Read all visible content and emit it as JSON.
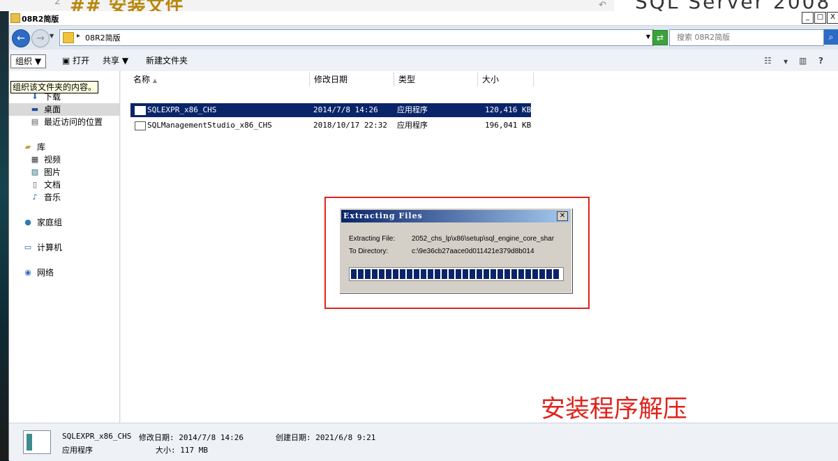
{
  "background": {
    "numeral": "2",
    "heading": "## 安装文件",
    "right_text": "SQL Server 2008"
  },
  "window": {
    "title": "08R2简版",
    "min_glyph": "_",
    "max_glyph": "□",
    "close_glyph": "X"
  },
  "address": {
    "path": "08R2简版",
    "search_placeholder": "搜索 08R2简版"
  },
  "toolbar": {
    "organize": "组织 ▼",
    "open": "打开",
    "share": "共享 ▼",
    "new_folder": "新建文件夹"
  },
  "tooltip": "组织该文件夹的内容。",
  "sidebar": {
    "items": [
      {
        "label": "下载",
        "icon": "download-icon"
      },
      {
        "label": "桌面",
        "icon": "desktop-icon",
        "selected": true
      },
      {
        "label": "最近访问的位置",
        "icon": "recent-places-icon"
      },
      {
        "label": "库",
        "icon": "library-icon"
      },
      {
        "label": "视频",
        "icon": "video-icon"
      },
      {
        "label": "图片",
        "icon": "pictures-icon"
      },
      {
        "label": "文档",
        "icon": "documents-icon"
      },
      {
        "label": "音乐",
        "icon": "music-icon"
      },
      {
        "label": "家庭组",
        "icon": "homegroup-icon"
      },
      {
        "label": "计算机",
        "icon": "computer-icon"
      },
      {
        "label": "网络",
        "icon": "network-icon"
      }
    ]
  },
  "columns": {
    "name": "名称",
    "modified": "修改日期",
    "type": "类型",
    "size": "大小"
  },
  "files": [
    {
      "name": "SQLEXPR_x86_CHS",
      "modified": "2014/7/8 14:26",
      "type": "应用程序",
      "size": "120,416 KB",
      "selected": true
    },
    {
      "name": "SQLManagementStudio_x86_CHS",
      "modified": "2018/10/17 22:32",
      "type": "应用程序",
      "size": "196,041 KB"
    }
  ],
  "dialog": {
    "title": "Extracting Files",
    "file_label": "Extracting File:",
    "file_value": "2052_chs_lp\\x86\\setup\\sql_engine_core_shar",
    "dir_label": "To Directory:",
    "dir_value": "c:\\9e36cb27aace0d011421e379d8b014",
    "progress": 1.0,
    "progress_segments": 30
  },
  "caption": "安装程序解压",
  "details": {
    "name": "SQLEXPR_x86_CHS",
    "modified": "修改日期: 2014/7/8 14:26",
    "created": "创建日期: 2021/6/8 9:21",
    "type": "应用程序",
    "size": "大小: 117 MB"
  },
  "colors": {
    "accent_red": "#e0231b",
    "selection": "#0a246a"
  }
}
